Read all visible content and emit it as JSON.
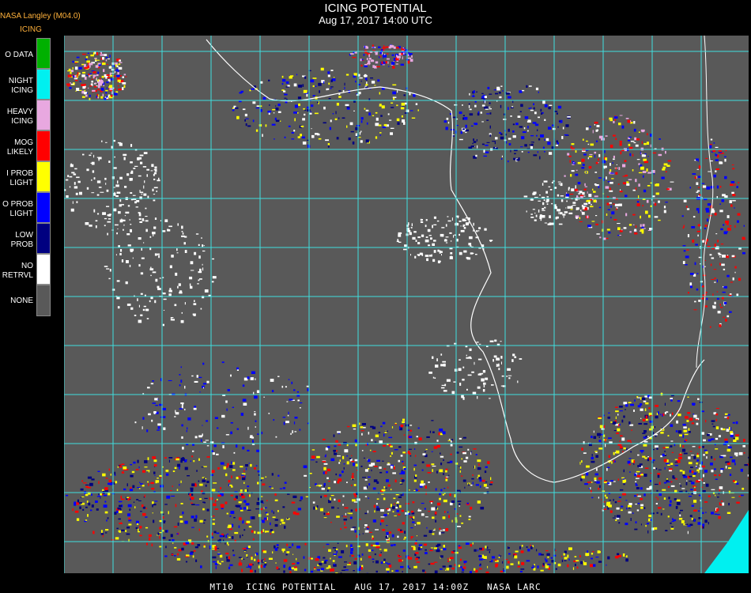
{
  "header": {
    "title": "ICING POTENTIAL",
    "subtitle": "Aug 17, 2017 14:00 UTC",
    "agency": "NASA Langley (M04.0)",
    "product": "ICING"
  },
  "legend": [
    {
      "label": "O DATA",
      "color": "#00b000"
    },
    {
      "label": "NIGHT\nICING",
      "color": "#00f0f0"
    },
    {
      "label": "HEAVY\nICING",
      "color": "#e8a8e0"
    },
    {
      "label": "MOG\nLIKELY",
      "color": "#ff0000"
    },
    {
      "label": "I PROB\nLIGHT",
      "color": "#ffff00"
    },
    {
      "label": "O PROB\nLIGHT",
      "color": "#0000ff"
    },
    {
      "label": "LOW\nPROB",
      "color": "#000080"
    },
    {
      "label": "NO\nRETRVL",
      "color": "#ffffff"
    },
    {
      "label": "NONE",
      "color": "#595959"
    }
  ],
  "map": {
    "background_color": "#595959",
    "grid_color": "#40e0e0",
    "coast_color": "#ffffff",
    "label_color": "#cc0000"
  },
  "footer": "MT10  ICING POTENTIAL   AUG 17, 2017 14:00Z   NASA LARC"
}
